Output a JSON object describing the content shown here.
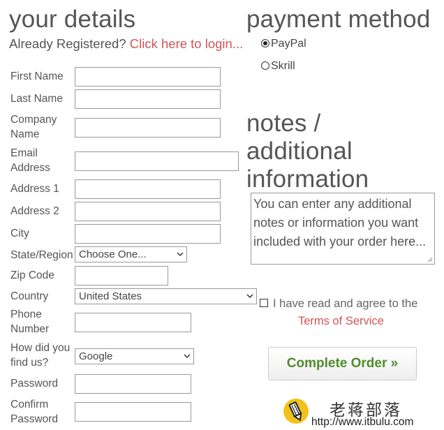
{
  "details": {
    "title": "your details",
    "registered_text": "Already Registered?",
    "login_link": "Click here to login...",
    "labels": {
      "first_name": "First Name",
      "last_name": "Last Name",
      "company_line1": "Company",
      "company_line2": "Name",
      "email_line1": "Email",
      "email_line2": "Address",
      "address1": "Address 1",
      "address2": "Address 2",
      "city": "City",
      "state": "State/Region",
      "zip": "Zip Code",
      "country": "Country",
      "phone_line1": "Phone",
      "phone_line2": "Number",
      "howfound_line1": "How did you",
      "howfound_line2": "find us?",
      "password": "Password",
      "confirm_line1": "Confirm",
      "confirm_line2": "Password"
    },
    "selects": {
      "state": "Choose One...",
      "country": "United States",
      "howfound": "Google"
    }
  },
  "payment": {
    "title": "payment method",
    "options": [
      {
        "label": "PayPal",
        "selected": true
      },
      {
        "label": "Skrill",
        "selected": false
      }
    ]
  },
  "notes": {
    "title_line1": "notes /",
    "title_line2": "additional",
    "title_line3": "information",
    "text": "You can enter any additional notes or information you want included with your order here..."
  },
  "agreement": {
    "text": "I have read and agree to the",
    "link": "Terms of Service",
    "checked": false
  },
  "complete_button": "Complete Order »",
  "watermark": {
    "chinese": "老蒋部落",
    "url": "http://www.itbulu.com"
  },
  "colors": {
    "link": "#d25555",
    "button_text": "#4f8c2b",
    "heading": "#555555"
  }
}
